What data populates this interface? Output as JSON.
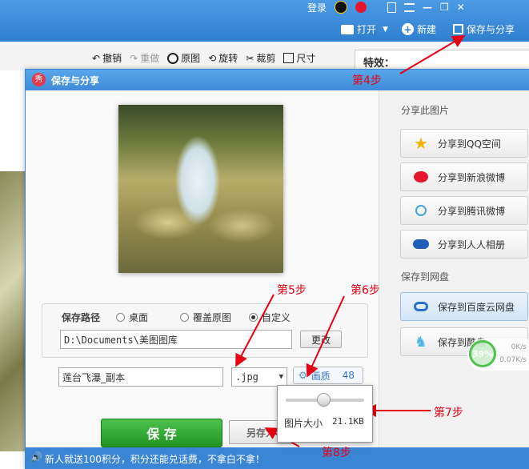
{
  "app": {
    "login": "登录",
    "open": "打开",
    "new": "新建",
    "save_share": "保存与分享",
    "minimize_glyph": "—",
    "restore_glyph": "❐",
    "close_glyph": "✕"
  },
  "editor": {
    "undo": "撤销",
    "redo": "重做",
    "original": "原图",
    "rotate": "旋转",
    "crop": "裁剪",
    "size": "尺寸",
    "effects_label": "特效："
  },
  "dialog": {
    "title": "保存与分享",
    "badge": "秀",
    "path_label": "保存路径",
    "radio_desktop": "桌面",
    "radio_overwrite": "覆盖原图",
    "radio_custom": "自定义",
    "path_value": "D:\\Documents\\美图图库",
    "change_button": "更改",
    "filename_value": "莲台飞瀑_副本",
    "format_value": ".jpg",
    "quality_label": "画质",
    "quality_value": "48",
    "quality_fraction": 0.48,
    "size_label": "图片大小",
    "size_value": "21.1KB",
    "save_button": "保 存",
    "saveas_button": "另存为",
    "status_text": "新人就送100积分，积分还能兑话费，不拿白不拿！"
  },
  "share": {
    "header": "分享此图片",
    "items": [
      {
        "label": "分享到QQ空间"
      },
      {
        "label": "分享到新浪微博"
      },
      {
        "label": "分享到腾讯微博"
      },
      {
        "label": "分享到人人相册"
      }
    ],
    "cloud_header": "保存到网盘",
    "cloud_items": [
      {
        "label": "保存到百度云网盘"
      },
      {
        "label": "保存到酷盘"
      }
    ]
  },
  "netspeed": {
    "percent": "39%",
    "up": "0K/s",
    "down": "0.07K/s"
  },
  "annotations": {
    "step4": "第4步",
    "step5": "第5步",
    "step6": "第6步",
    "step7": "第7步",
    "step8": "第8步"
  },
  "colors": {
    "accent_blue": "#3a86d5",
    "save_green": "#2fa22f",
    "arrow_red": "#e60012"
  }
}
